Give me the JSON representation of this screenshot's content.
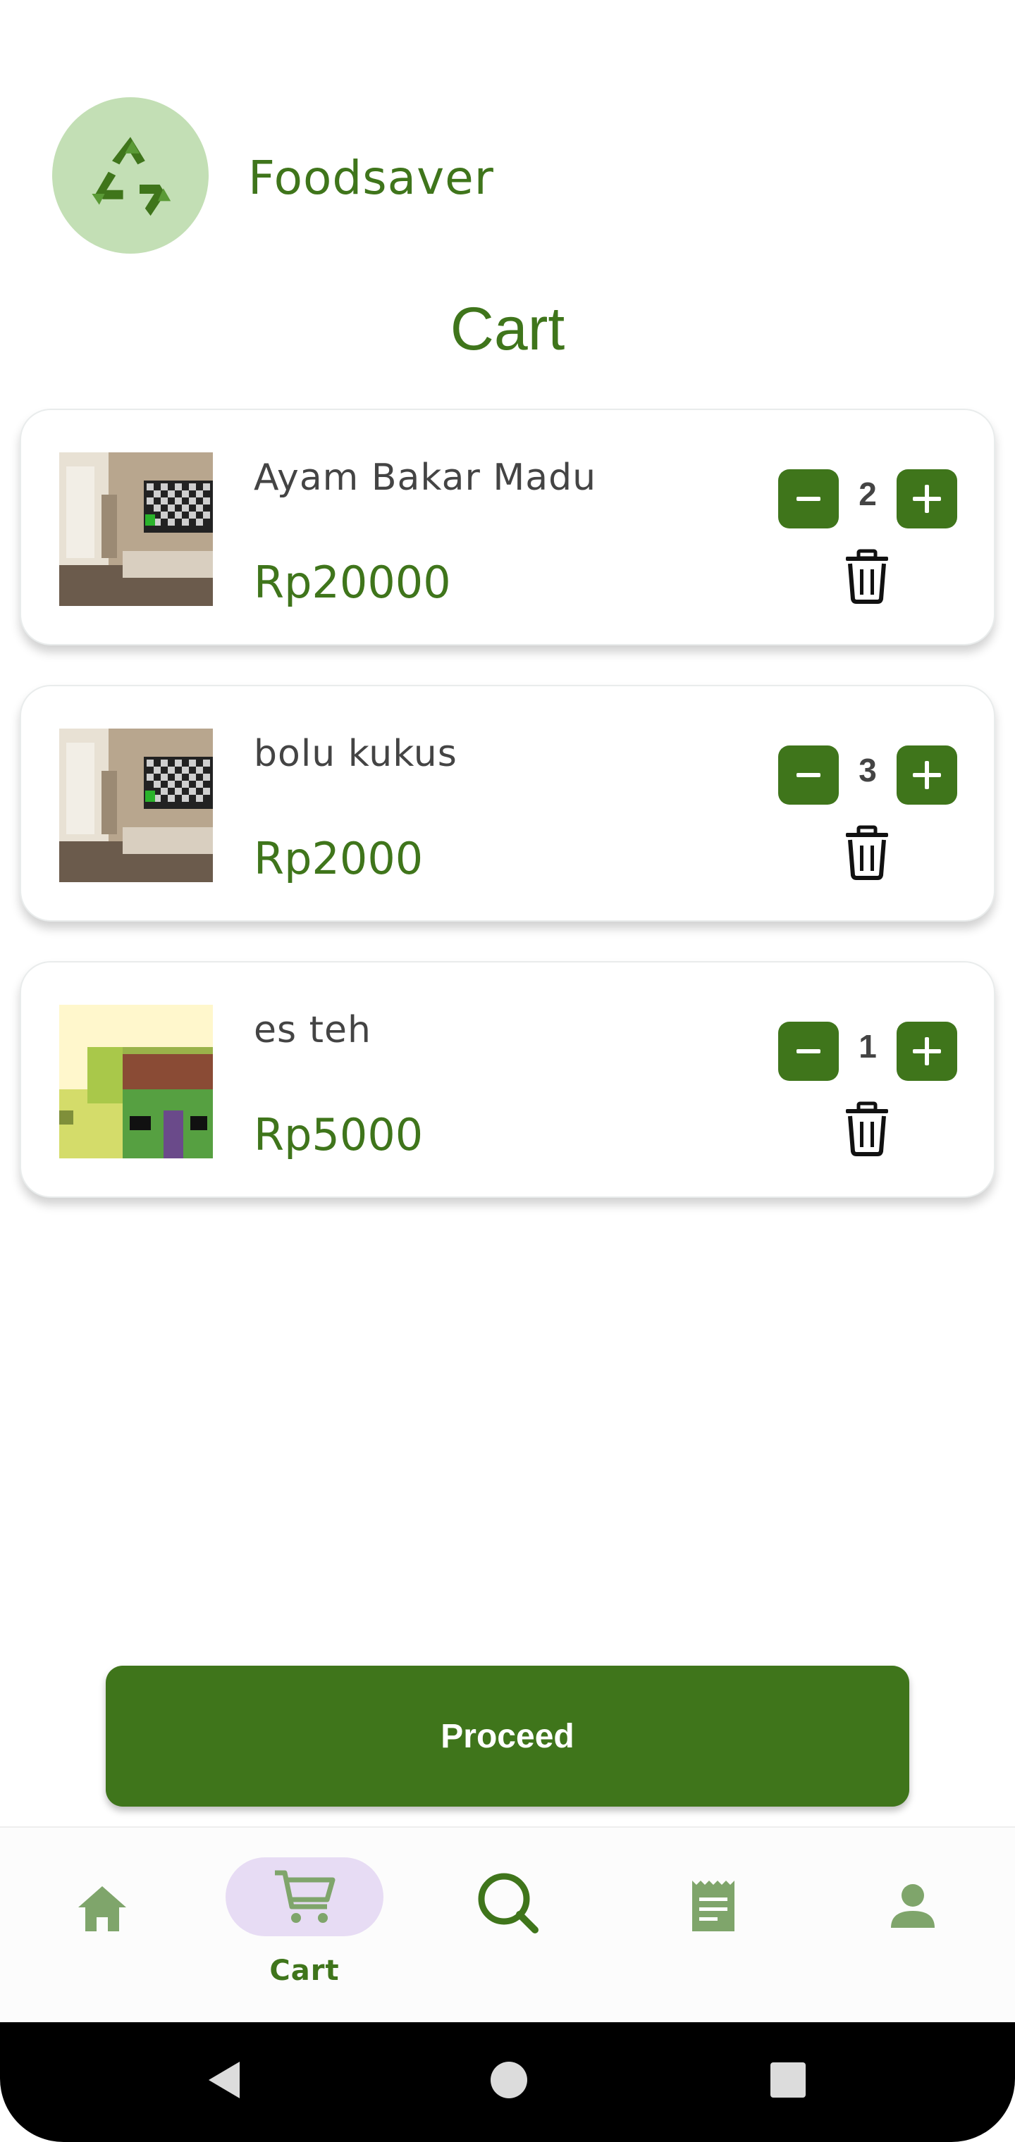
{
  "app": {
    "brand": "Foodsaver",
    "logo_icon": "recycle-icon"
  },
  "page": {
    "title": "Cart"
  },
  "cart_items": [
    {
      "name": "Ayam Bakar Madu",
      "price": "Rp20000",
      "quantity": "2",
      "image": "living-room-photo"
    },
    {
      "name": "bolu kukus",
      "price": "Rp2000",
      "quantity": "3",
      "image": "living-room-photo"
    },
    {
      "name": "es teh",
      "price": "Rp5000",
      "quantity": "1",
      "image": "pixel-house-image"
    }
  ],
  "actions": {
    "proceed_label": "Proceed"
  },
  "nav": {
    "items": [
      {
        "icon": "home-icon",
        "label": ""
      },
      {
        "icon": "cart-icon",
        "label": "Cart",
        "active": true
      },
      {
        "icon": "search-icon",
        "label": ""
      },
      {
        "icon": "receipt-icon",
        "label": ""
      },
      {
        "icon": "person-icon",
        "label": ""
      }
    ]
  },
  "colors": {
    "primary": "#3f751b",
    "logo_bg": "#c3dfb5",
    "active_pill": "#e7dcf4",
    "nav_icon_muted": "#7fa56b"
  }
}
